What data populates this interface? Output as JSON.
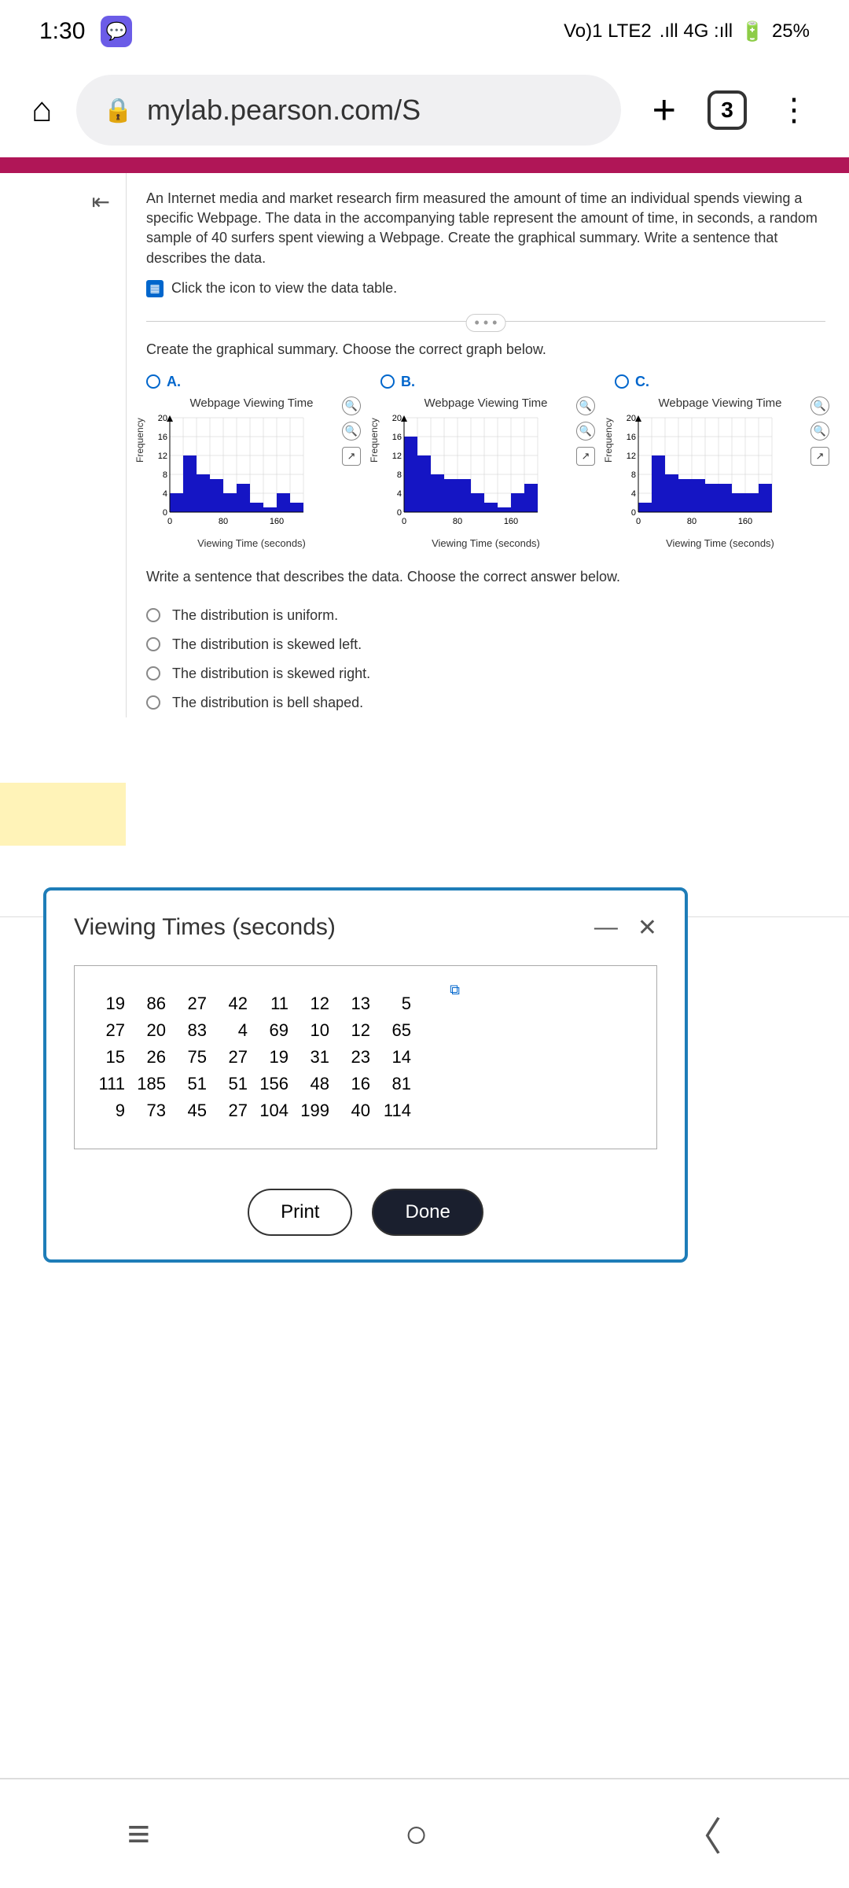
{
  "status": {
    "time": "1:30",
    "network": "Vo)1 LTE2",
    "signal": ".ıll 4G :ıll",
    "battery": "25%"
  },
  "browser": {
    "url": "mylab.pearson.com/S",
    "tab_count": "3"
  },
  "problem": {
    "text": "An Internet media and market research firm measured the amount of time an individual spends viewing a specific Webpage. The data in the accompanying table represent the amount of time, in seconds, a random sample of 40 surfers spent viewing a Webpage. Create the graphical summary. Write a sentence that describes the data.",
    "data_link": "Click the icon to view the data table."
  },
  "prompt1": "Create the graphical summary. Choose the correct graph below.",
  "chart_common": {
    "title": "Webpage Viewing Time",
    "ylabel": "Frequency",
    "xlabel": "Viewing Time (seconds)"
  },
  "options": {
    "a": "A.",
    "b": "B.",
    "c": "C."
  },
  "chart_data": [
    {
      "type": "bar",
      "option": "A",
      "title": "Webpage Viewing Time",
      "xlabel": "Viewing Time (seconds)",
      "ylabel": "Frequency",
      "x_ticks": [
        0,
        80,
        160
      ],
      "y_ticks": [
        0,
        4,
        8,
        12,
        16,
        20
      ],
      "ylim": [
        0,
        20
      ],
      "categories": [
        "0-20",
        "20-40",
        "40-60",
        "60-80",
        "80-100",
        "100-120",
        "120-140",
        "140-160",
        "160-180",
        "180-200"
      ],
      "values": [
        4,
        12,
        8,
        7,
        4,
        6,
        2,
        1,
        4,
        2
      ]
    },
    {
      "type": "bar",
      "option": "B",
      "title": "Webpage Viewing Time",
      "xlabel": "Viewing Time (seconds)",
      "ylabel": "Frequency",
      "x_ticks": [
        0,
        80,
        160
      ],
      "y_ticks": [
        0,
        4,
        8,
        12,
        16,
        20
      ],
      "ylim": [
        0,
        20
      ],
      "categories": [
        "0-20",
        "20-40",
        "40-60",
        "60-80",
        "80-100",
        "100-120",
        "120-140",
        "140-160",
        "160-180",
        "180-200"
      ],
      "values": [
        16,
        12,
        8,
        7,
        7,
        4,
        2,
        1,
        4,
        6
      ]
    },
    {
      "type": "bar",
      "option": "C",
      "title": "Webpage Viewing Time",
      "xlabel": "Viewing Time (seconds)",
      "ylabel": "Frequency",
      "x_ticks": [
        0,
        80,
        160
      ],
      "y_ticks": [
        0,
        4,
        8,
        12,
        16,
        20
      ],
      "ylim": [
        0,
        20
      ],
      "categories": [
        "0-20",
        "20-40",
        "40-60",
        "60-80",
        "80-100",
        "100-120",
        "120-140",
        "140-160",
        "160-180",
        "180-200"
      ],
      "values": [
        2,
        12,
        8,
        7,
        7,
        6,
        6,
        4,
        4,
        6
      ]
    }
  ],
  "prompt2": "Write a sentence that describes the data. Choose the correct answer below.",
  "answers": {
    "a": "The distribution is uniform.",
    "b": "The distribution is skewed left.",
    "c": "The distribution is skewed right.",
    "d": "The distribution is bell shaped."
  },
  "modal": {
    "title": "Viewing Times (seconds)",
    "rows": [
      [
        "19",
        "86",
        "27",
        "42",
        "11",
        "12",
        "13",
        "5"
      ],
      [
        "27",
        "20",
        "83",
        "4",
        "69",
        "10",
        "12",
        "65"
      ],
      [
        "15",
        "26",
        "75",
        "27",
        "19",
        "31",
        "23",
        "14"
      ],
      [
        "111",
        "185",
        "51",
        "51",
        "156",
        "48",
        "16",
        "81"
      ],
      [
        "9",
        "73",
        "45",
        "27",
        "104",
        "199",
        "40",
        "114"
      ]
    ],
    "print": "Print",
    "done": "Done"
  }
}
